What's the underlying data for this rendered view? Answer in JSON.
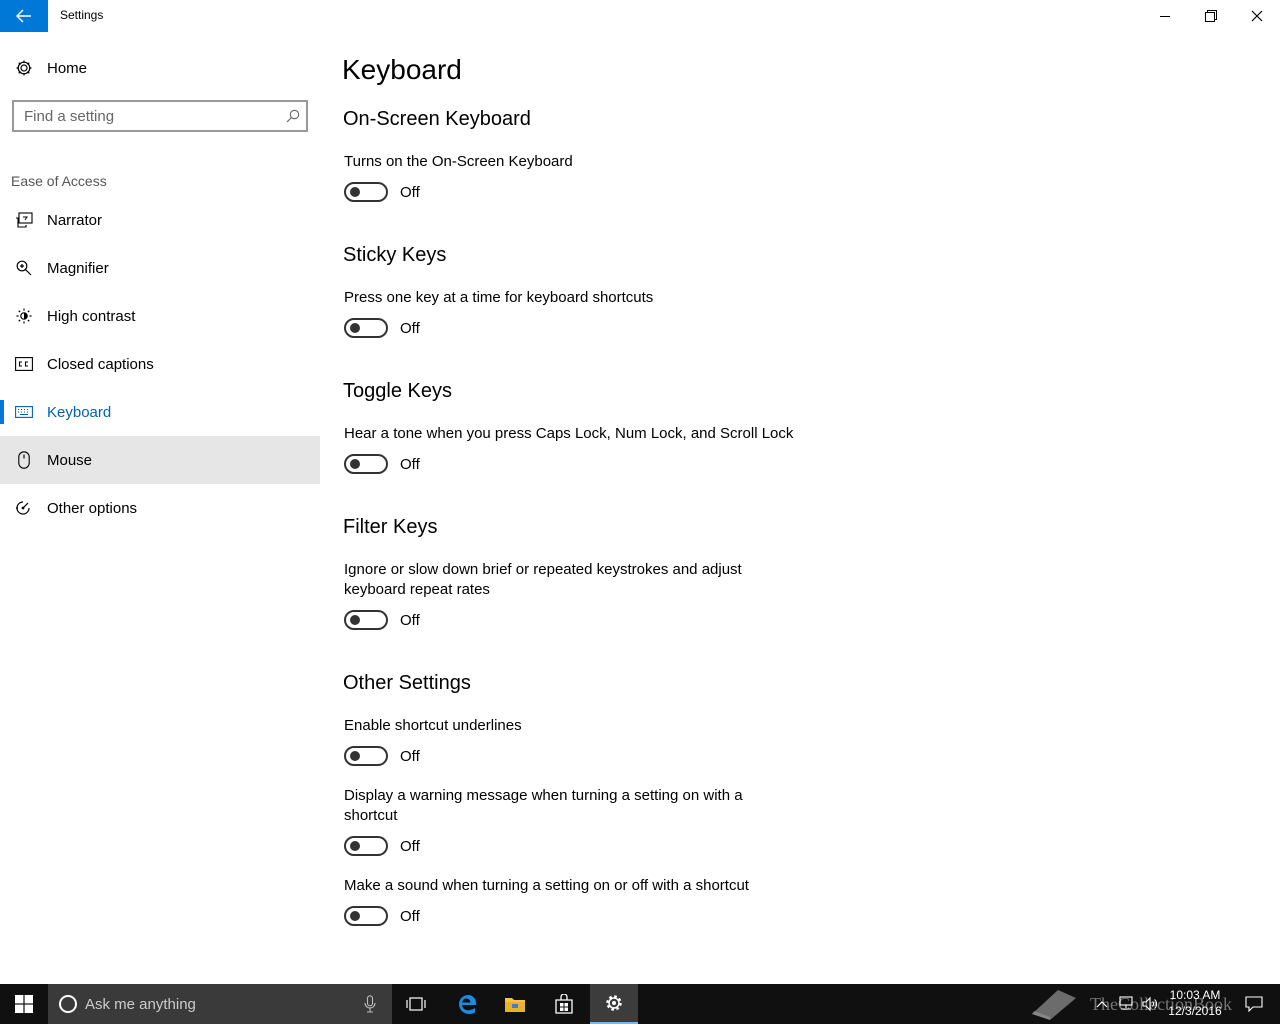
{
  "window": {
    "title": "Settings"
  },
  "sidebar": {
    "home_label": "Home",
    "search_placeholder": "Find a setting",
    "section_label": "Ease of Access",
    "items": [
      {
        "label": "Narrator",
        "icon": "narrator-icon"
      },
      {
        "label": "Magnifier",
        "icon": "magnifier-icon"
      },
      {
        "label": "High contrast",
        "icon": "high-contrast-icon"
      },
      {
        "label": "Closed captions",
        "icon": "closed-captions-icon"
      },
      {
        "label": "Keyboard",
        "icon": "keyboard-icon",
        "selected": true
      },
      {
        "label": "Mouse",
        "icon": "mouse-icon",
        "hovered": true
      },
      {
        "label": "Other options",
        "icon": "other-options-icon"
      }
    ]
  },
  "main": {
    "title": "Keyboard",
    "groups": [
      {
        "title": "On-Screen Keyboard",
        "settings": [
          {
            "description": "Turns on the On-Screen Keyboard",
            "state": "Off"
          }
        ]
      },
      {
        "title": "Sticky Keys",
        "settings": [
          {
            "description": "Press one key at a time for keyboard shortcuts",
            "state": "Off"
          }
        ]
      },
      {
        "title": "Toggle Keys",
        "settings": [
          {
            "description": "Hear a tone when you press Caps Lock, Num Lock, and Scroll Lock",
            "state": "Off"
          }
        ]
      },
      {
        "title": "Filter Keys",
        "settings": [
          {
            "description": "Ignore or slow down brief or repeated keystrokes and adjust keyboard repeat rates",
            "state": "Off"
          }
        ]
      },
      {
        "title": "Other Settings",
        "settings": [
          {
            "description": "Enable shortcut underlines",
            "state": "Off"
          },
          {
            "description": "Display a warning message when turning a setting on with a shortcut",
            "state": "Off"
          },
          {
            "description": "Make a sound when turning a setting on or off with a shortcut",
            "state": "Off"
          }
        ]
      }
    ]
  },
  "taskbar": {
    "search_placeholder": "Ask me anything",
    "time": "10:03 AM",
    "date": "12/3/2016",
    "watermark": "TheCollectionBook"
  },
  "colors": {
    "accent": "#0078d7",
    "selected_text": "#0063b1",
    "taskbar": "#101010",
    "hover": "#e6e6e6"
  }
}
